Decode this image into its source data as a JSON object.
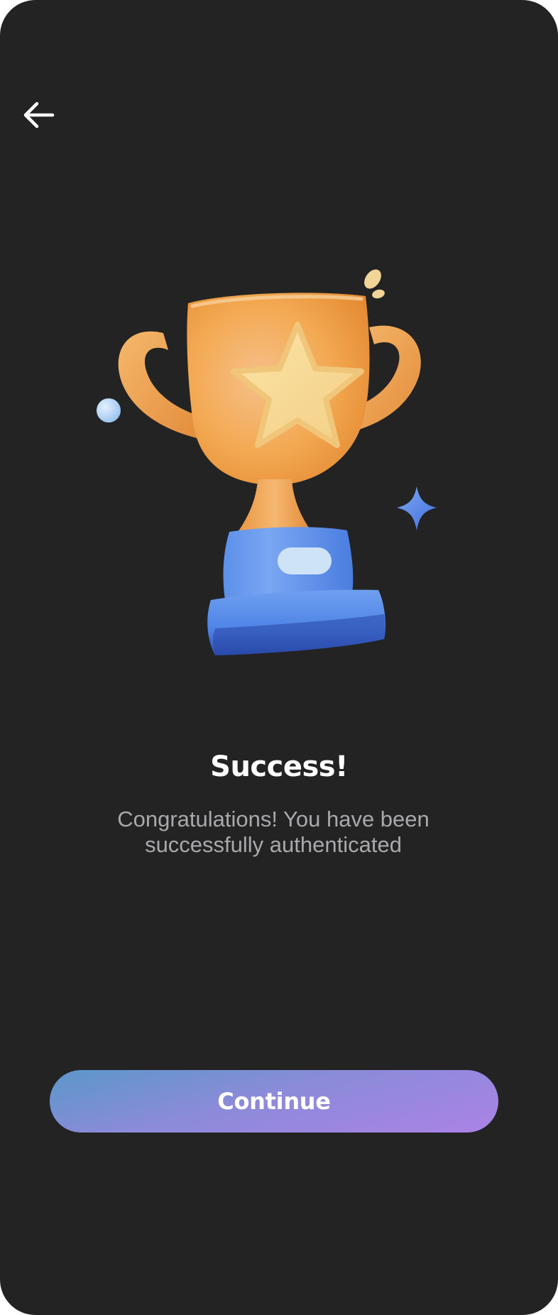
{
  "nav": {
    "back_icon": "arrow-left-icon"
  },
  "illustration": {
    "icon": "trophy-star-icon"
  },
  "content": {
    "title": "Success!",
    "message_line1": "Congratulations! You have been",
    "message_line2": "successfully authenticated"
  },
  "actions": {
    "continue_label": "Continue"
  },
  "colors": {
    "background": "#232323",
    "title": "#ffffff",
    "message": "#a9a9ad",
    "button_gradient_start": "#5b97c9",
    "button_gradient_end": "#ab82e6",
    "trophy_cup": "#f3a952",
    "trophy_base": "#4f84e6"
  }
}
